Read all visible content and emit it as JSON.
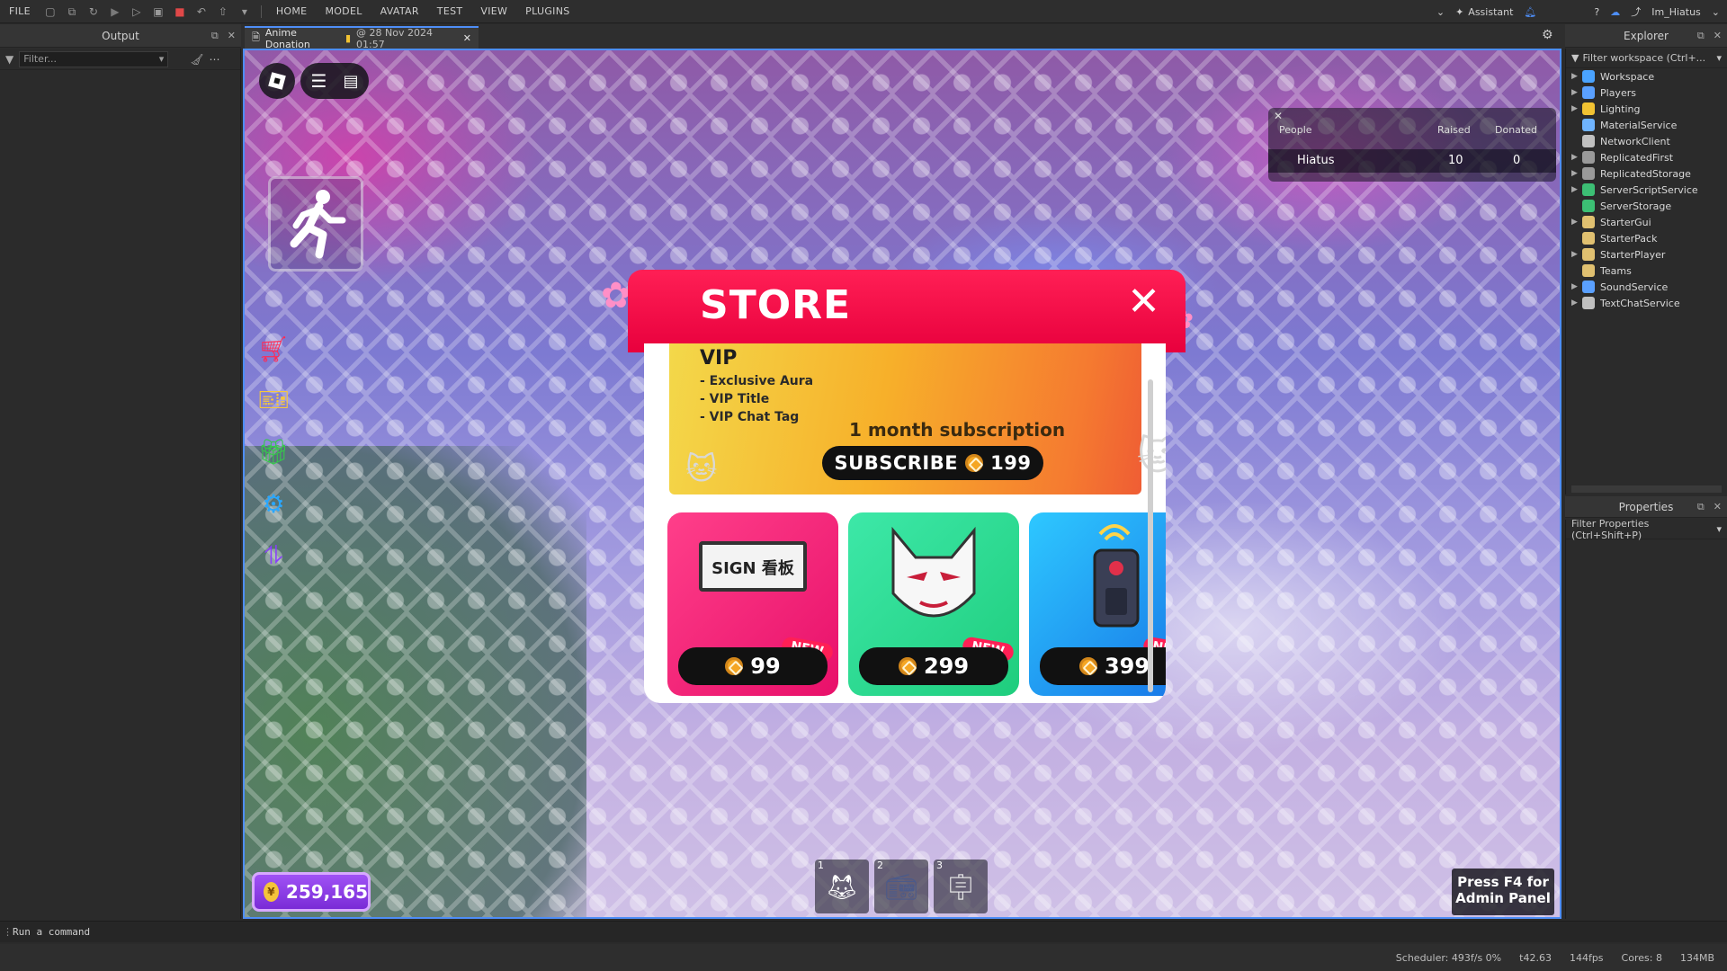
{
  "menubar": {
    "file": "FILE",
    "items": [
      "HOME",
      "MODEL",
      "AVATAR",
      "TEST",
      "VIEW",
      "PLUGINS"
    ],
    "assistant": "Assistant",
    "username": "Im_Hiatus"
  },
  "output": {
    "title": "Output",
    "filter_placeholder": "Filter..."
  },
  "document_tab": {
    "title": "Anime Donation",
    "timestamp": "@ 28 Nov 2024 01:57"
  },
  "leaderboard": {
    "headers": {
      "people": "People",
      "raised": "Raised",
      "donated": "Donated"
    },
    "rows": [
      {
        "name": "Hiatus",
        "raised": "10",
        "donated": "0"
      }
    ]
  },
  "store": {
    "title": "STORE",
    "close": "✕",
    "vip": {
      "title": "VIP",
      "perks": [
        "- Exclusive Aura",
        "- VIP Title",
        "- VIP Chat Tag"
      ],
      "subscription": "1 month subscription",
      "subscribe_label": "SUBSCRIBE",
      "subscribe_price": "199"
    },
    "items": [
      {
        "name": "sign",
        "price": "99",
        "badge": "NEW",
        "art_text": "SIGN 看板"
      },
      {
        "name": "mask",
        "price": "299",
        "badge": "NEW"
      },
      {
        "name": "radio",
        "price": "399",
        "badge": "NEW"
      }
    ]
  },
  "currency": {
    "value": "259,165"
  },
  "hotbar": {
    "slots": [
      "1",
      "2",
      "3"
    ]
  },
  "admin_hint": {
    "line1": "Press F4 for",
    "line2": "Admin Panel"
  },
  "explorer": {
    "title": "Explorer",
    "filter_placeholder": "Filter workspace (Ctrl+...",
    "items": [
      {
        "label": "Workspace",
        "icon": "globe-icon",
        "color": "#4aa3ff",
        "expandable": true
      },
      {
        "label": "Players",
        "icon": "players-icon",
        "color": "#5aa0ff",
        "expandable": true
      },
      {
        "label": "Lighting",
        "icon": "bulb-icon",
        "color": "#f1c232",
        "expandable": true
      },
      {
        "label": "MaterialService",
        "icon": "material-icon",
        "color": "#6fb4ff",
        "expandable": false
      },
      {
        "label": "NetworkClient",
        "icon": "network-icon",
        "color": "#c0c0c0",
        "expandable": false
      },
      {
        "label": "ReplicatedFirst",
        "icon": "replicated-first-icon",
        "color": "#9a9a9a",
        "expandable": true
      },
      {
        "label": "ReplicatedStorage",
        "icon": "replicated-storage-icon",
        "color": "#9a9a9a",
        "expandable": true
      },
      {
        "label": "ServerScriptService",
        "icon": "server-script-icon",
        "color": "#3cbf74",
        "expandable": true
      },
      {
        "label": "ServerStorage",
        "icon": "server-storage-icon",
        "color": "#3cbf74",
        "expandable": false
      },
      {
        "label": "StarterGui",
        "icon": "starter-gui-icon",
        "color": "#e0c070",
        "expandable": true
      },
      {
        "label": "StarterPack",
        "icon": "starter-pack-icon",
        "color": "#e0c070",
        "expandable": false
      },
      {
        "label": "StarterPlayer",
        "icon": "starter-player-icon",
        "color": "#e0c070",
        "expandable": true
      },
      {
        "label": "Teams",
        "icon": "teams-icon",
        "color": "#e0c070",
        "expandable": false
      },
      {
        "label": "SoundService",
        "icon": "sound-icon",
        "color": "#5aa0ff",
        "expandable": true
      },
      {
        "label": "TextChatService",
        "icon": "chat-icon",
        "color": "#c0c0c0",
        "expandable": true
      }
    ]
  },
  "properties": {
    "title": "Properties",
    "filter_placeholder": "Filter Properties (Ctrl+Shift+P)"
  },
  "command_bar": {
    "placeholder": "Run a command"
  },
  "status_bar": {
    "scheduler": "Scheduler: 493f/s 0%",
    "time": "t42.63",
    "fps": "144fps",
    "cores": "Cores: 8",
    "memory": "134MB"
  },
  "colors": {
    "accent": "#4e8ef7",
    "store_red": "#ff1f55",
    "robux_gold": "#f5a623"
  }
}
